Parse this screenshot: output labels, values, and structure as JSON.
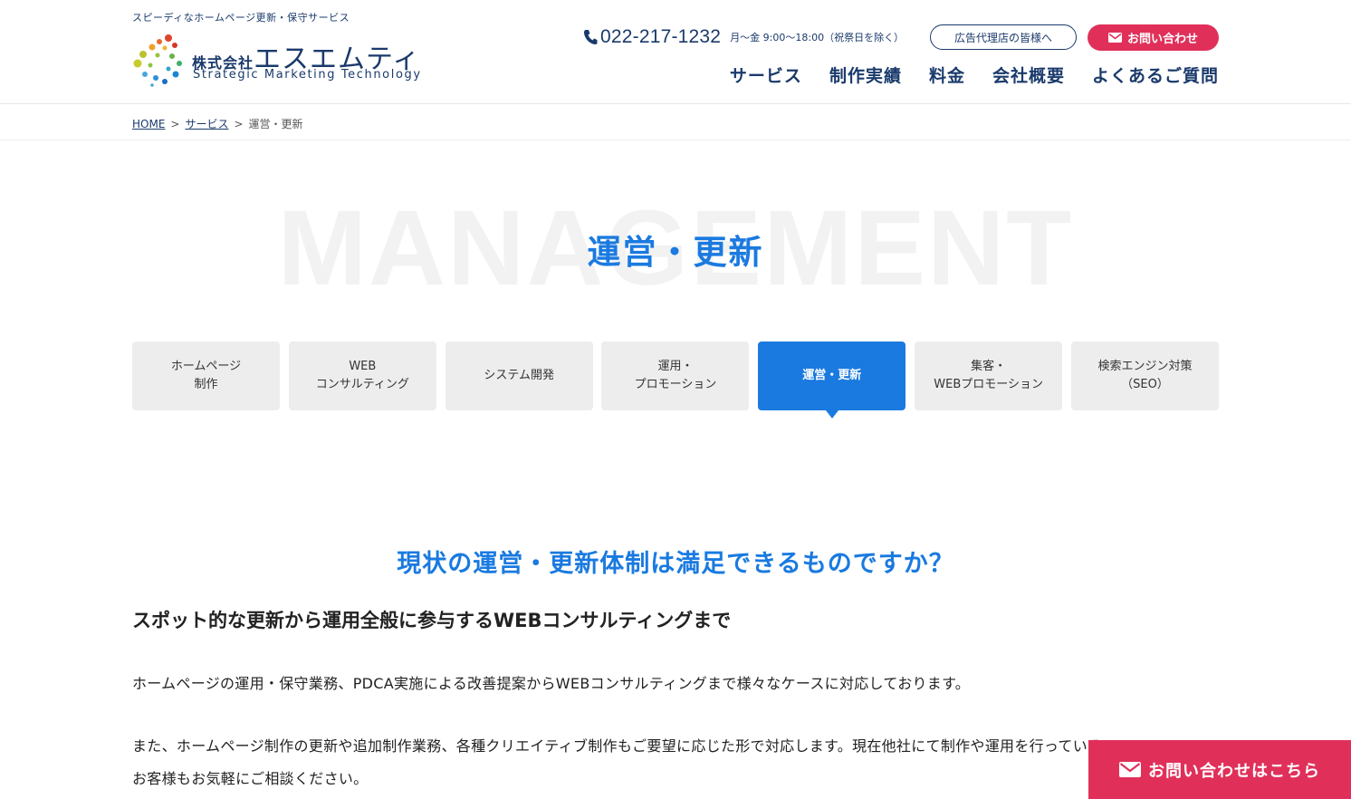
{
  "header": {
    "tagline": "スピーディなホームページ更新・保守サービス",
    "logo": {
      "kabushiki": "株式会社",
      "name": "エスエムティ",
      "english": "Strategic Marketing Technology"
    },
    "phone": {
      "number": "022-217-1232",
      "hours": "月〜金 9:00〜18:00（祝祭日を除く）",
      "icon": "phone-icon"
    },
    "agency_button": "広告代理店の皆様へ",
    "contact_button": "お問い合わせ",
    "nav": [
      "サービス",
      "制作実績",
      "料金",
      "会社概要",
      "よくあるご質問"
    ]
  },
  "breadcrumb": {
    "home": "HOME",
    "separator": ">",
    "service": "サービス",
    "current": "運営・更新"
  },
  "hero": {
    "background_text": "MANAGEMENT",
    "title": "運営・更新"
  },
  "tabs": [
    {
      "label": "ホームページ\n制作",
      "active": false
    },
    {
      "label": "WEB\nコンサルティング",
      "active": false
    },
    {
      "label": "システム開発",
      "active": false
    },
    {
      "label": "運用・\nプロモーション",
      "active": false
    },
    {
      "label": "運営・更新",
      "active": true
    },
    {
      "label": "集客・\nWEBプロモーション",
      "active": false
    },
    {
      "label": "検索エンジン対策\n（SEO）",
      "active": false
    }
  ],
  "content": {
    "section_title": "現状の運営・更新体制は満足できるものですか？",
    "subhead": "スポット的な更新から運用全般に参与するWEBコンサルティングまで",
    "para1": "ホームページの運用・保守業務、PDCA実施による改善提案からWEBコンサルティングまで様々なケースに対応しております。",
    "para2": "また、ホームページ制作の更新や追加制作業務、各種クリエイティブ制作もご要望に応じた形で対応します。現在他社にて制作や運用を行っている\nお客様もお気軽にご相談ください。"
  },
  "float_cta": "お問い合わせはこちら",
  "colors": {
    "navy": "#1a3a6b",
    "accent_blue": "#1a7ae0",
    "cta_pink": "#e0305a",
    "tab_gray": "#ededed"
  }
}
